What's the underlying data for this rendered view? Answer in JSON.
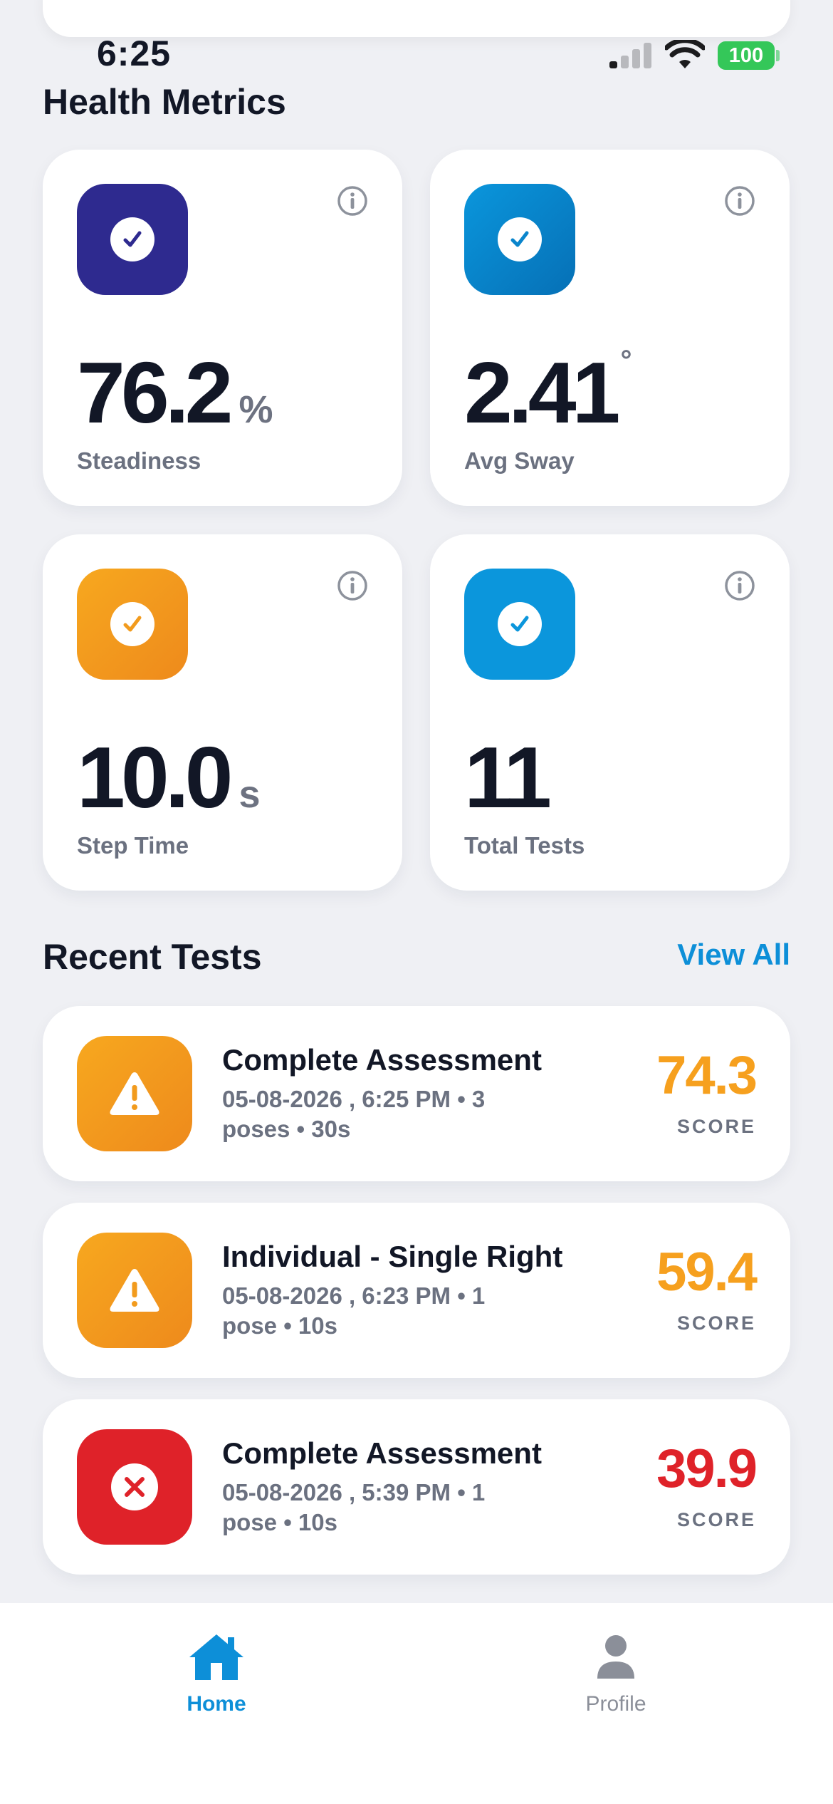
{
  "status_bar": {
    "time": "6:25",
    "battery": "100"
  },
  "health_metrics": {
    "title": "Health Metrics",
    "cards": [
      {
        "value": "76.2",
        "unit": "%",
        "label": "Steadiness",
        "icon": "check-circle-icon",
        "color": "#2e2a8f"
      },
      {
        "value": "2.41",
        "unit": "°",
        "label": "Avg Sway",
        "icon": "check-circle-icon",
        "color": "#0a85cc"
      },
      {
        "value": "10.0",
        "unit": "s",
        "label": "Step Time",
        "icon": "check-circle-icon",
        "color": "#f29b1d"
      },
      {
        "value": "11",
        "unit": "",
        "label": "Total Tests",
        "icon": "check-circle-icon",
        "color": "#0b96dc"
      }
    ]
  },
  "recent_tests": {
    "title": "Recent Tests",
    "view_all": "View All",
    "items": [
      {
        "title": "Complete Assessment",
        "meta": "05-08-2026 , 6:25 PM • 3 poses • 30s",
        "score": "74.3",
        "score_label": "SCORE",
        "status": "warning",
        "icon": "warning-icon",
        "color": "#f6a01e"
      },
      {
        "title": "Individual - Single Right",
        "meta": "05-08-2026 , 6:23 PM • 1 pose • 10s",
        "score": "59.4",
        "score_label": "SCORE",
        "status": "warning",
        "icon": "warning-icon",
        "color": "#f6a01e"
      },
      {
        "title": "Complete Assessment",
        "meta": "05-08-2026 , 5:39 PM • 1 pose • 10s",
        "score": "39.9",
        "score_label": "SCORE",
        "status": "error",
        "icon": "x-circle-icon",
        "color": "#df2229"
      }
    ]
  },
  "tab_bar": {
    "home": {
      "label": "Home",
      "active": true,
      "color": "#0d8fd8"
    },
    "profile": {
      "label": "Profile",
      "active": false,
      "color": "#8b8f99"
    }
  }
}
